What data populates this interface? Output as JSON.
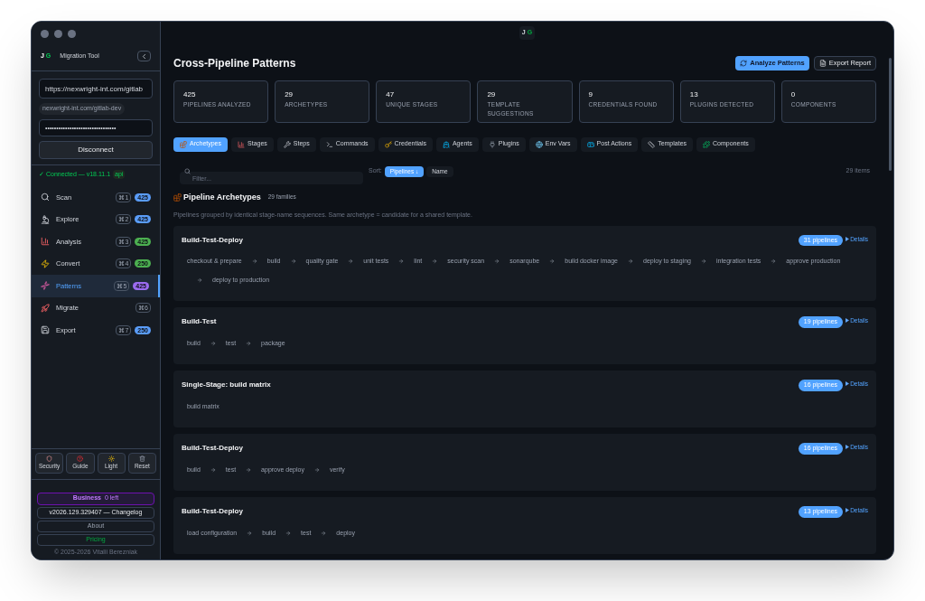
{
  "window": {
    "badge_left": "J",
    "badge_right": "G"
  },
  "sidebar": {
    "logo_left": "J",
    "logo_right": "G",
    "title": "Migration Tool",
    "url_value": "https://nexwright-int.com/gitlab",
    "url_hint": "nexwright-int.com/gitlab-dev",
    "token_value": "••••••••••••••••••••••••••••••••",
    "disconnect": "Disconnect",
    "status": "✓ Connected — v18.11.1",
    "status_tag": "api",
    "items": [
      {
        "label": "Scan",
        "shortcut": "⌘1",
        "count": "425",
        "color": "#5a9cf8",
        "selected": false
      },
      {
        "label": "Explore",
        "shortcut": "⌘2",
        "count": "425",
        "color": "#5a9cf8",
        "selected": false
      },
      {
        "label": "Analysis",
        "shortcut": "⌘3",
        "count": "425",
        "color": "#4caf50",
        "selected": false
      },
      {
        "label": "Convert",
        "shortcut": "⌘4",
        "count": "250",
        "color": "#4caf50",
        "selected": false
      },
      {
        "label": "Patterns",
        "shortcut": "⌘5",
        "count": "425",
        "color": "#9b6bf0",
        "selected": true
      },
      {
        "label": "Migrate",
        "shortcut": "⌘6",
        "selected": false
      },
      {
        "label": "Export",
        "shortcut": "⌘7",
        "count": "250",
        "color": "#5a9cf8",
        "selected": false
      }
    ],
    "tools": [
      {
        "label": "Security"
      },
      {
        "label": "Guide"
      },
      {
        "label": "Light"
      },
      {
        "label": "Reset"
      }
    ],
    "plan": "Business",
    "plan_left": "0 left",
    "version": "v2026.129.329407 — Changelog",
    "about": "About",
    "pricing": "Pricing",
    "copyright": "© 2025-2026 Vitalii Berezniak"
  },
  "main": {
    "title": "Cross-Pipeline Patterns",
    "actions": [
      {
        "label": "Analyze Patterns",
        "kind": "primary"
      },
      {
        "label": "Export Report",
        "kind": "secondary"
      }
    ],
    "stats": [
      {
        "value": "425",
        "label": "PIPELINES ANALYZED"
      },
      {
        "value": "29",
        "label": "ARCHETYPES"
      },
      {
        "value": "47",
        "label": "UNIQUE STAGES"
      },
      {
        "value": "29",
        "label": "TEMPLATE SUGGESTIONS"
      },
      {
        "value": "9",
        "label": "CREDENTIALS FOUND"
      },
      {
        "value": "13",
        "label": "PLUGINS DETECTED"
      },
      {
        "value": "0",
        "label": "COMPONENTS"
      }
    ],
    "tabs": [
      {
        "label": "Archetypes",
        "selected": true
      },
      {
        "label": "Stages",
        "selected": false
      },
      {
        "label": "Steps",
        "selected": false
      },
      {
        "label": "Commands",
        "selected": false
      },
      {
        "label": "Credentials",
        "selected": false
      },
      {
        "label": "Agents",
        "selected": false
      },
      {
        "label": "Plugins",
        "selected": false
      },
      {
        "label": "Env Vars",
        "selected": false
      },
      {
        "label": "Post Actions",
        "selected": false
      },
      {
        "label": "Templates",
        "selected": false
      },
      {
        "label": "Components",
        "selected": false
      }
    ],
    "filter_placeholder": "Filter...",
    "sort_label": "Sort:",
    "sorts": [
      {
        "label": "Pipelines ↓",
        "selected": true
      },
      {
        "label": "Name",
        "selected": false
      }
    ],
    "item_count": "29 items",
    "section_title": "Pipeline Archetypes",
    "section_count": "29 families",
    "section_desc": "Pipelines grouped by identical stage-name sequences. Same archetype = candidate for a shared template.",
    "archetypes": [
      {
        "name": "Build-Test-Deploy",
        "pipelines": "31 pipelines",
        "details": "Details",
        "stages": [
          "checkout & prepare",
          "build",
          "quality gate",
          "unit tests",
          "lint",
          "security scan",
          "sonarqube",
          "build docker image",
          "deploy to staging",
          "integration tests",
          "approve production",
          "deploy to production"
        ]
      },
      {
        "name": "Build-Test",
        "pipelines": "19 pipelines",
        "details": "Details",
        "stages": [
          "build",
          "test",
          "package"
        ]
      },
      {
        "name": "Single-Stage: build matrix",
        "pipelines": "16 pipelines",
        "details": "Details",
        "stages": [
          "build matrix"
        ]
      },
      {
        "name": "Build-Test-Deploy",
        "pipelines": "16 pipelines",
        "details": "Details",
        "stages": [
          "build",
          "test",
          "approve deploy",
          "verify"
        ]
      },
      {
        "name": "Build-Test-Deploy",
        "pipelines": "13 pipelines",
        "details": "Details",
        "stages": [
          "load configuration",
          "build",
          "test",
          "deploy"
        ]
      }
    ]
  }
}
